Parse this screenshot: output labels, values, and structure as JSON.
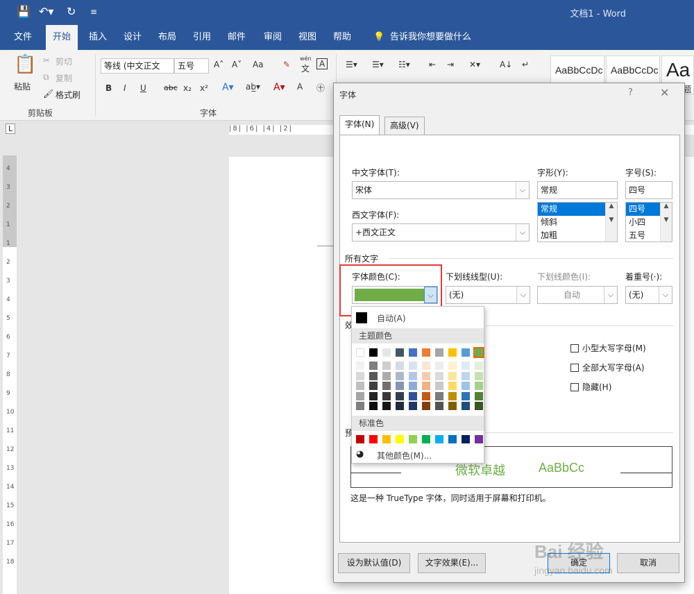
{
  "app": {
    "doc_title": "文档1 - Word",
    "quick_access": [
      "save-icon",
      "undo-icon",
      "redo-icon",
      "customize-icon"
    ]
  },
  "ribbon_tabs": [
    "文件",
    "开始",
    "插入",
    "设计",
    "布局",
    "引用",
    "邮件",
    "审阅",
    "视图",
    "帮助"
  ],
  "active_tab": "开始",
  "tell_me": "告诉我你想要做什么",
  "ribbon": {
    "clipboard": {
      "paste": "粘贴",
      "cut": "剪切",
      "copy": "复制",
      "format_painter": "格式刷",
      "group": "剪贴板"
    },
    "font": {
      "font_name": "等线 (中文正文",
      "font_size": "五号",
      "group": "字体",
      "bold": "B",
      "italic": "I",
      "underline": "U",
      "strike": "abc",
      "sub": "x₂",
      "sup": "x²",
      "case": "Aa",
      "pinyin_top": "wén",
      "pinyin_bottom": "文",
      "border_char": "A"
    },
    "styles": [
      "AaBbCcDc",
      "AaBbCcDc",
      "Aa"
    ],
    "styles_sub": "题"
  },
  "ruler": {
    "marks": "|8|  |6|  |4|  |2|",
    "v_numbers": [
      "4",
      "3",
      "2",
      "1",
      "1",
      "2",
      "3",
      "4",
      "5",
      "6",
      "7",
      "8",
      "9",
      "10",
      "11",
      "12",
      "13",
      "14",
      "15",
      "16",
      "17",
      "18"
    ]
  },
  "dialog": {
    "title": "字体",
    "help": "?",
    "close": "✕",
    "tabs": [
      "字体(N)",
      "高级(V)"
    ],
    "cn_font_label": "中文字体(T):",
    "cn_font_value": "宋体",
    "west_font_label": "西文字体(F):",
    "west_font_value": "+西文正文",
    "style_label": "字形(Y):",
    "style_value": "常规",
    "style_list": [
      "常规",
      "倾斜",
      "加粗"
    ],
    "size_label": "字号(S):",
    "size_value": "四号",
    "size_list": [
      "四号",
      "小四",
      "五号"
    ],
    "all_text": "所有文字",
    "font_color_label": "字体颜色(C):",
    "font_color": "#70ad47",
    "underline_style_label": "下划线线型(U):",
    "underline_style_value": "(无)",
    "underline_color_label": "下划线颜色(I):",
    "underline_color_value": "自动",
    "emphasis_label": "着重号(·):",
    "emphasis_value": "(无)",
    "effects_label": "效",
    "preview_label": "预",
    "checks": [
      "小型大写字母(M)",
      "全部大写字母(A)",
      "隐藏(H)"
    ],
    "preview_cn": "微软卓越",
    "preview_en": "AaBbCc",
    "preview_note": "这是一种 TrueType 字体，同时适用于屏幕和打印机。",
    "btn_default": "设为默认值(D)",
    "btn_effects": "文字效果(E)...",
    "btn_ok": "确定",
    "btn_cancel": "取消"
  },
  "color_popup": {
    "auto": "自动(A)",
    "theme_head": "主题颜色",
    "standard_head": "标准色",
    "more": "其他颜色(M)...",
    "theme_top": [
      "#ffffff",
      "#000000",
      "#e7e6e6",
      "#44546a",
      "#4472c4",
      "#ed7d31",
      "#a5a5a5",
      "#ffc000",
      "#5b9bd5",
      "#70ad47"
    ],
    "theme_shades": [
      [
        "#f2f2f2",
        "#7f7f7f",
        "#d0cece",
        "#d6dce4",
        "#d9e2f3",
        "#fbe5d5",
        "#ededed",
        "#fff2cc",
        "#deebf6",
        "#e2efd9"
      ],
      [
        "#d8d8d8",
        "#595959",
        "#aeabab",
        "#adb9ca",
        "#b4c6e7",
        "#f7cbac",
        "#dbdbdb",
        "#fee599",
        "#bdd7ee",
        "#c5e0b3"
      ],
      [
        "#bfbfbf",
        "#3f3f3f",
        "#757070",
        "#8496b0",
        "#8eaadb",
        "#f4b183",
        "#c9c9c9",
        "#ffd965",
        "#9dc3e6",
        "#a8d08d"
      ],
      [
        "#a5a5a5",
        "#262626",
        "#3a3838",
        "#323f4f",
        "#2f5496",
        "#c55a11",
        "#7b7b7b",
        "#bf8f00",
        "#2e75b5",
        "#538135"
      ],
      [
        "#7f7f7f",
        "#0c0c0c",
        "#171616",
        "#222a35",
        "#1f3864",
        "#833c0b",
        "#525252",
        "#7f6000",
        "#1e4e79",
        "#375623"
      ]
    ],
    "standard": [
      "#c00000",
      "#ff0000",
      "#ffc000",
      "#ffff00",
      "#92d050",
      "#00b050",
      "#00b0f0",
      "#0070c0",
      "#002060",
      "#7030a0"
    ]
  },
  "watermark": {
    "line1": "Bai 经验",
    "line2": "jingyan.baidu.com"
  }
}
